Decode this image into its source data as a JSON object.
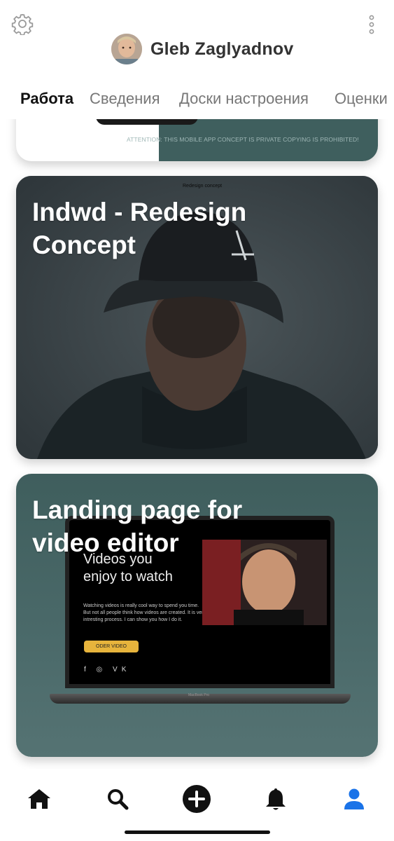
{
  "header": {
    "settings_icon": "gear-icon",
    "more_icon": "vertical-dots-icon",
    "profile_name": "Gleb Zaglyadnov"
  },
  "tabs": [
    {
      "label": "Работа",
      "active": true
    },
    {
      "label": "Сведения",
      "active": false
    },
    {
      "label": "Доски настроения",
      "active": false
    },
    {
      "label": "Оценки",
      "active": false
    }
  ],
  "feed": {
    "cards": [
      {
        "title": "",
        "notice": "ATTENTION: THIS MOBILE APP CONCEPT IS PRIVATE COPYING IS PROHIBITED!"
      },
      {
        "title": "Indwd - Redesign Concept",
        "tiny_caption": "Redesign concept"
      },
      {
        "title": "Landing page for video editor",
        "screen": {
          "headline": "Videos you enjoy to watch",
          "body": "Watching videos is really cool way to spend you time. But not all people think how videos are created. It is very intresting process. I can show you how I do it.",
          "button": "ODER VIDEO",
          "social": "f ◎ VK",
          "laptop_brand": "MacBook Pro"
        }
      }
    ]
  },
  "bottom_nav": {
    "items": [
      {
        "name": "home",
        "icon": "home-icon",
        "active": false
      },
      {
        "name": "search",
        "icon": "search-icon",
        "active": false
      },
      {
        "name": "add",
        "icon": "plus-circle-icon",
        "active": false
      },
      {
        "name": "notifications",
        "icon": "bell-icon",
        "active": false
      },
      {
        "name": "profile",
        "icon": "user-icon",
        "active": true
      }
    ],
    "accent_color": "#1a73e8",
    "icon_color": "#111111"
  }
}
